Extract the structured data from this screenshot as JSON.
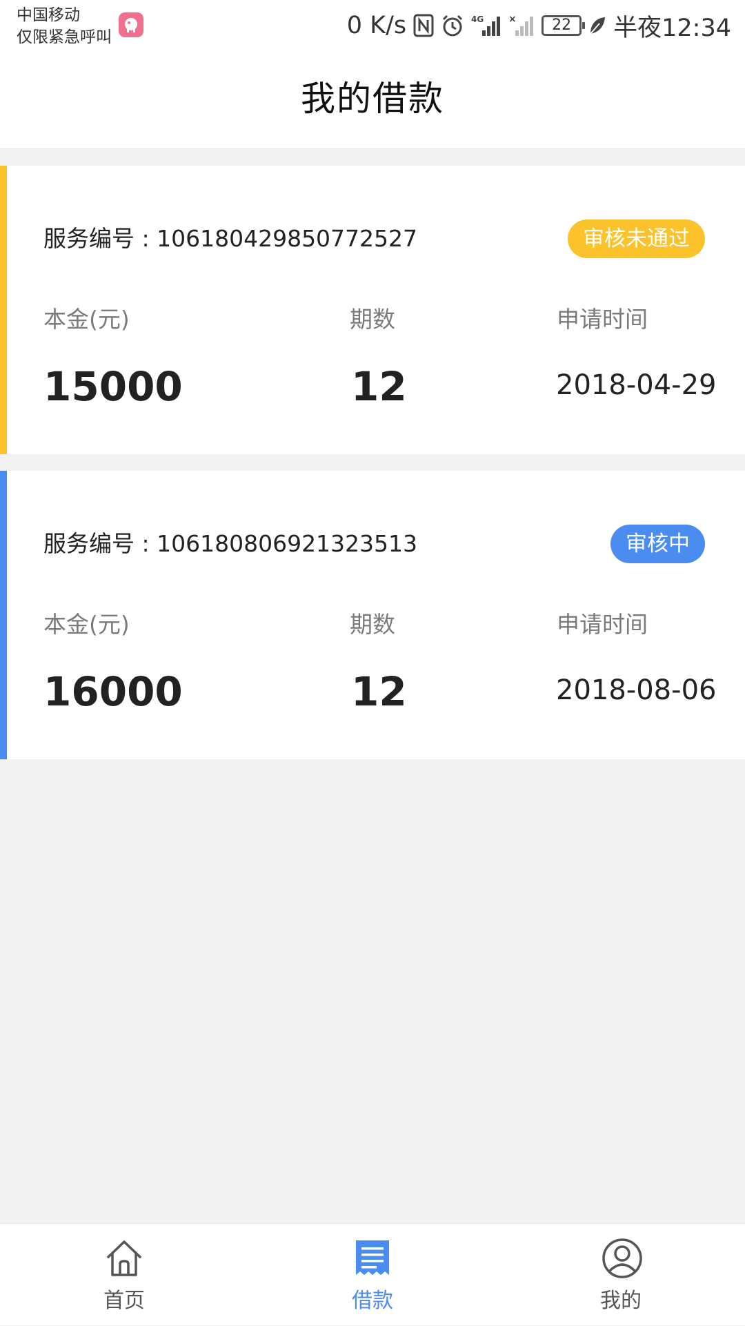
{
  "status_bar": {
    "carrier_line1": "中国移动",
    "carrier_line2": "仅限紧急呼叫",
    "net_speed": "0 K/s",
    "nfc": "N",
    "signal_4g": "4G",
    "signal_x": "×",
    "battery_level": "22",
    "clock": "半夜12:34"
  },
  "header": {
    "title": "我的借款"
  },
  "loans": [
    {
      "service_label": "服务编号 : ",
      "service_no": "106180429850772527",
      "status": "审核未通过",
      "status_color": "#fbc22c",
      "accent_color": "#fbc22c",
      "principal_label": "本金(元)",
      "principal": "15000",
      "periods_label": "期数",
      "periods": "12",
      "date_label": "申请时间",
      "date": "2018-04-29"
    },
    {
      "service_label": "服务编号 : ",
      "service_no": "106180806921323513",
      "status": "审核中",
      "status_color": "#4a8cf0",
      "accent_color": "#4a8cf0",
      "principal_label": "本金(元)",
      "principal": "16000",
      "periods_label": "期数",
      "periods": "12",
      "date_label": "申请时间",
      "date": "2018-08-06"
    }
  ],
  "nav": {
    "items": [
      {
        "label": "首页",
        "icon": "home-icon",
        "active": false
      },
      {
        "label": "借款",
        "icon": "loan-document-icon",
        "active": true
      },
      {
        "label": "我的",
        "icon": "profile-icon",
        "active": false
      }
    ],
    "active_color": "#4a8cf0",
    "inactive_color": "#555555"
  }
}
